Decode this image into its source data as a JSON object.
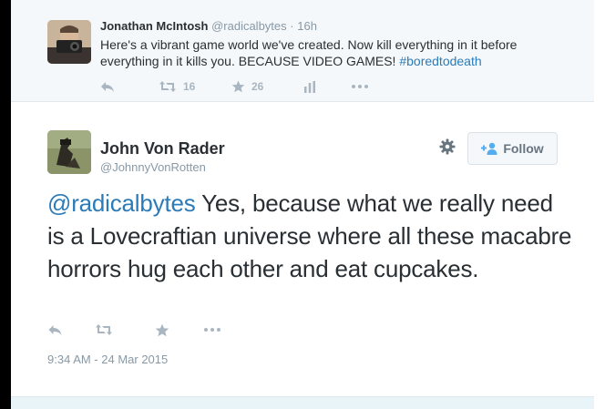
{
  "parent": {
    "name": "Jonathan McIntosh",
    "handle": "@radicalbytes",
    "separator": "·",
    "time": "16h",
    "text": "Here's a vibrant game world we've created. Now kill everything in it before everything in it kills you. BECAUSE VIDEO GAMES! ",
    "hashtag": "#boredtodeath",
    "retweets": "16",
    "favorites": "26",
    "icons": [
      "reply-icon",
      "retweet-icon",
      "favorite-icon",
      "analytics-icon",
      "more-icon"
    ]
  },
  "main": {
    "name": "John Von Rader",
    "handle": "@JohnnyVonRotten",
    "follow_label": "Follow",
    "mention": "@radicalbytes",
    "text": " Yes, because what we really need is a Lovecraftian universe where all these macabre horrors hug each other and eat cupcakes.",
    "timestamp": "9:34 AM - 24 Mar 2015",
    "icons": [
      "gear-icon",
      "follow-person-icon",
      "reply-icon",
      "retweet-icon",
      "favorite-icon",
      "more-icon"
    ]
  },
  "colors": {
    "link": "#2b7bb9",
    "text": "#292f33",
    "muted": "#8899a6",
    "icon": "#a9b6c1",
    "parent_bg": "#f5f8fa"
  }
}
